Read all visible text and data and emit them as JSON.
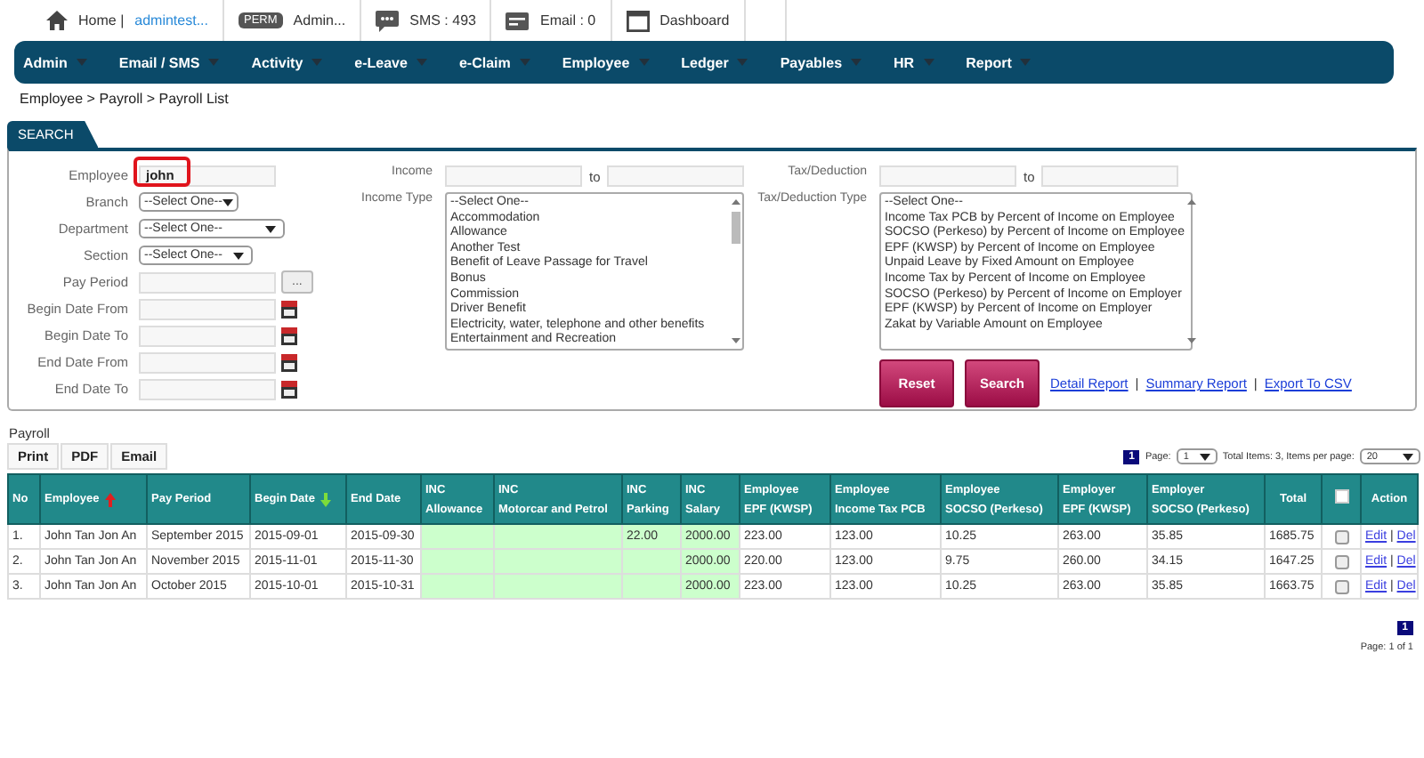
{
  "top_bar": {
    "items": [
      {
        "kind": "home",
        "label": "Home |",
        "link": "admintest..."
      },
      {
        "kind": "perm",
        "badge": "PERM",
        "label": "Admin..."
      },
      {
        "kind": "sms",
        "label": "SMS : 493"
      },
      {
        "kind": "email",
        "label": "Email : 0"
      },
      {
        "kind": "dashboard",
        "label": "Dashboard"
      }
    ]
  },
  "nav": {
    "items": [
      "Admin",
      "Email / SMS",
      "Activity",
      "e-Leave",
      "e-Claim",
      "Employee",
      "Ledger",
      "Payables",
      "HR",
      "Report"
    ]
  },
  "breadcrumb": "Employee > Payroll > Payroll List",
  "search": {
    "tab": "SEARCH",
    "fields": [
      {
        "label": "Employee",
        "kind": "text",
        "value": "john",
        "highlighted": true
      },
      {
        "label": "Branch",
        "kind": "select",
        "value": "--Select One--"
      },
      {
        "label": "Department",
        "kind": "select",
        "value": "--Select One--"
      },
      {
        "label": "Section",
        "kind": "select",
        "value": "--Select One--"
      },
      {
        "label": "Pay Period",
        "kind": "picker",
        "button": "..."
      },
      {
        "label": "Begin Date From",
        "kind": "date"
      },
      {
        "label": "Begin Date To",
        "kind": "date"
      },
      {
        "label": "End Date From",
        "kind": "date"
      },
      {
        "label": "End Date To",
        "kind": "date"
      }
    ],
    "income": {
      "label": "Income",
      "to": "to"
    },
    "income_type": {
      "label": "Income Type",
      "options": [
        "--Select One--",
        "Accommodation",
        "Allowance",
        "Another Test",
        "Benefit of Leave Passage for Travel",
        "Bonus",
        "Commission",
        "Driver Benefit",
        "Electricity, water, telephone and other benefits",
        "Entertainment and Recreation"
      ]
    },
    "tax": {
      "label": "Tax/Deduction",
      "to": "to"
    },
    "tax_type": {
      "label": "Tax/Deduction Type",
      "options": [
        "--Select One--",
        "Income Tax PCB by Percent of Income on Employee",
        "SOCSO (Perkeso) by Percent of Income on Employee",
        "EPF (KWSP) by Percent of Income on Employee",
        "Unpaid Leave by Fixed Amount on Employee",
        "Income Tax by Percent of Income on Employee",
        "SOCSO (Perkeso) by Percent of Income on Employer",
        "EPF (KWSP) by Percent of Income on Employer",
        "Zakat by Variable Amount on Employee"
      ]
    },
    "buttons": [
      "Reset",
      "Search"
    ],
    "links": [
      "Detail Report",
      "Summary Report",
      "Export To CSV"
    ],
    "link_separator": "|"
  },
  "payroll": {
    "title": "Payroll",
    "export_buttons": [
      "Print",
      "PDF",
      "Email"
    ],
    "pager": {
      "page_button": "1",
      "page_label": "Page:",
      "page_select": "1",
      "total_text": "Total Items: 3, Items per page:",
      "per_page_select": "20"
    },
    "table": {
      "columns": [
        {
          "lines": [
            "No"
          ]
        },
        {
          "lines": [
            "Employee"
          ],
          "sorted_ascending": true
        },
        {
          "lines": [
            "Pay Period"
          ]
        },
        {
          "lines": [
            "Begin Date"
          ],
          "sorted_descending": true
        },
        {
          "lines": [
            "End Date"
          ]
        },
        {
          "lines": [
            "INC",
            "Allowance"
          ],
          "highlight": true
        },
        {
          "lines": [
            "INC",
            "Motorcar and Petrol"
          ],
          "highlight": true
        },
        {
          "lines": [
            "INC",
            "Parking"
          ],
          "highlight": true
        },
        {
          "lines": [
            "INC",
            "Salary"
          ],
          "highlight": true
        },
        {
          "lines": [
            "Employee",
            "EPF (KWSP)"
          ]
        },
        {
          "lines": [
            "Employee",
            "Income Tax PCB"
          ]
        },
        {
          "lines": [
            "Employee",
            "SOCSO (Perkeso)"
          ]
        },
        {
          "lines": [
            "Employer",
            "EPF (KWSP)"
          ]
        },
        {
          "lines": [
            "Employer",
            "SOCSO (Perkeso)"
          ]
        },
        {
          "lines": [
            "Total"
          ]
        },
        {
          "kind": "checkbox",
          "checked": false
        },
        {
          "lines": [
            "Action"
          ]
        }
      ],
      "rows": [
        {
          "cells": [
            "1.",
            "John Tan Jon An",
            "September 2015",
            "2015-09-01",
            "2015-09-30",
            null,
            null,
            "22.00",
            "2000.00",
            "223.00",
            "123.00",
            "10.25",
            "263.00",
            "35.85",
            "1685.75"
          ],
          "checked": false,
          "actions": [
            "Edit",
            "Del"
          ],
          "action_separator": "|"
        },
        {
          "cells": [
            "2.",
            "John Tan Jon An",
            "November 2015",
            "2015-11-01",
            "2015-11-30",
            null,
            null,
            null,
            "2000.00",
            "220.00",
            "123.00",
            "9.75",
            "260.00",
            "34.15",
            "1647.25"
          ],
          "checked": false,
          "actions": [
            "Edit",
            "Del"
          ],
          "action_separator": "|"
        },
        {
          "cells": [
            "3.",
            "John Tan Jon An",
            "October 2015",
            "2015-10-01",
            "2015-10-31",
            null,
            null,
            null,
            "2000.00",
            "223.00",
            "123.00",
            "10.25",
            "263.00",
            "35.85",
            "1663.75"
          ],
          "checked": false,
          "actions": [
            "Edit",
            "Del"
          ],
          "action_separator": "|"
        }
      ]
    },
    "footer": {
      "page_button": "1",
      "page_info": "Page: 1 of 1"
    }
  }
}
